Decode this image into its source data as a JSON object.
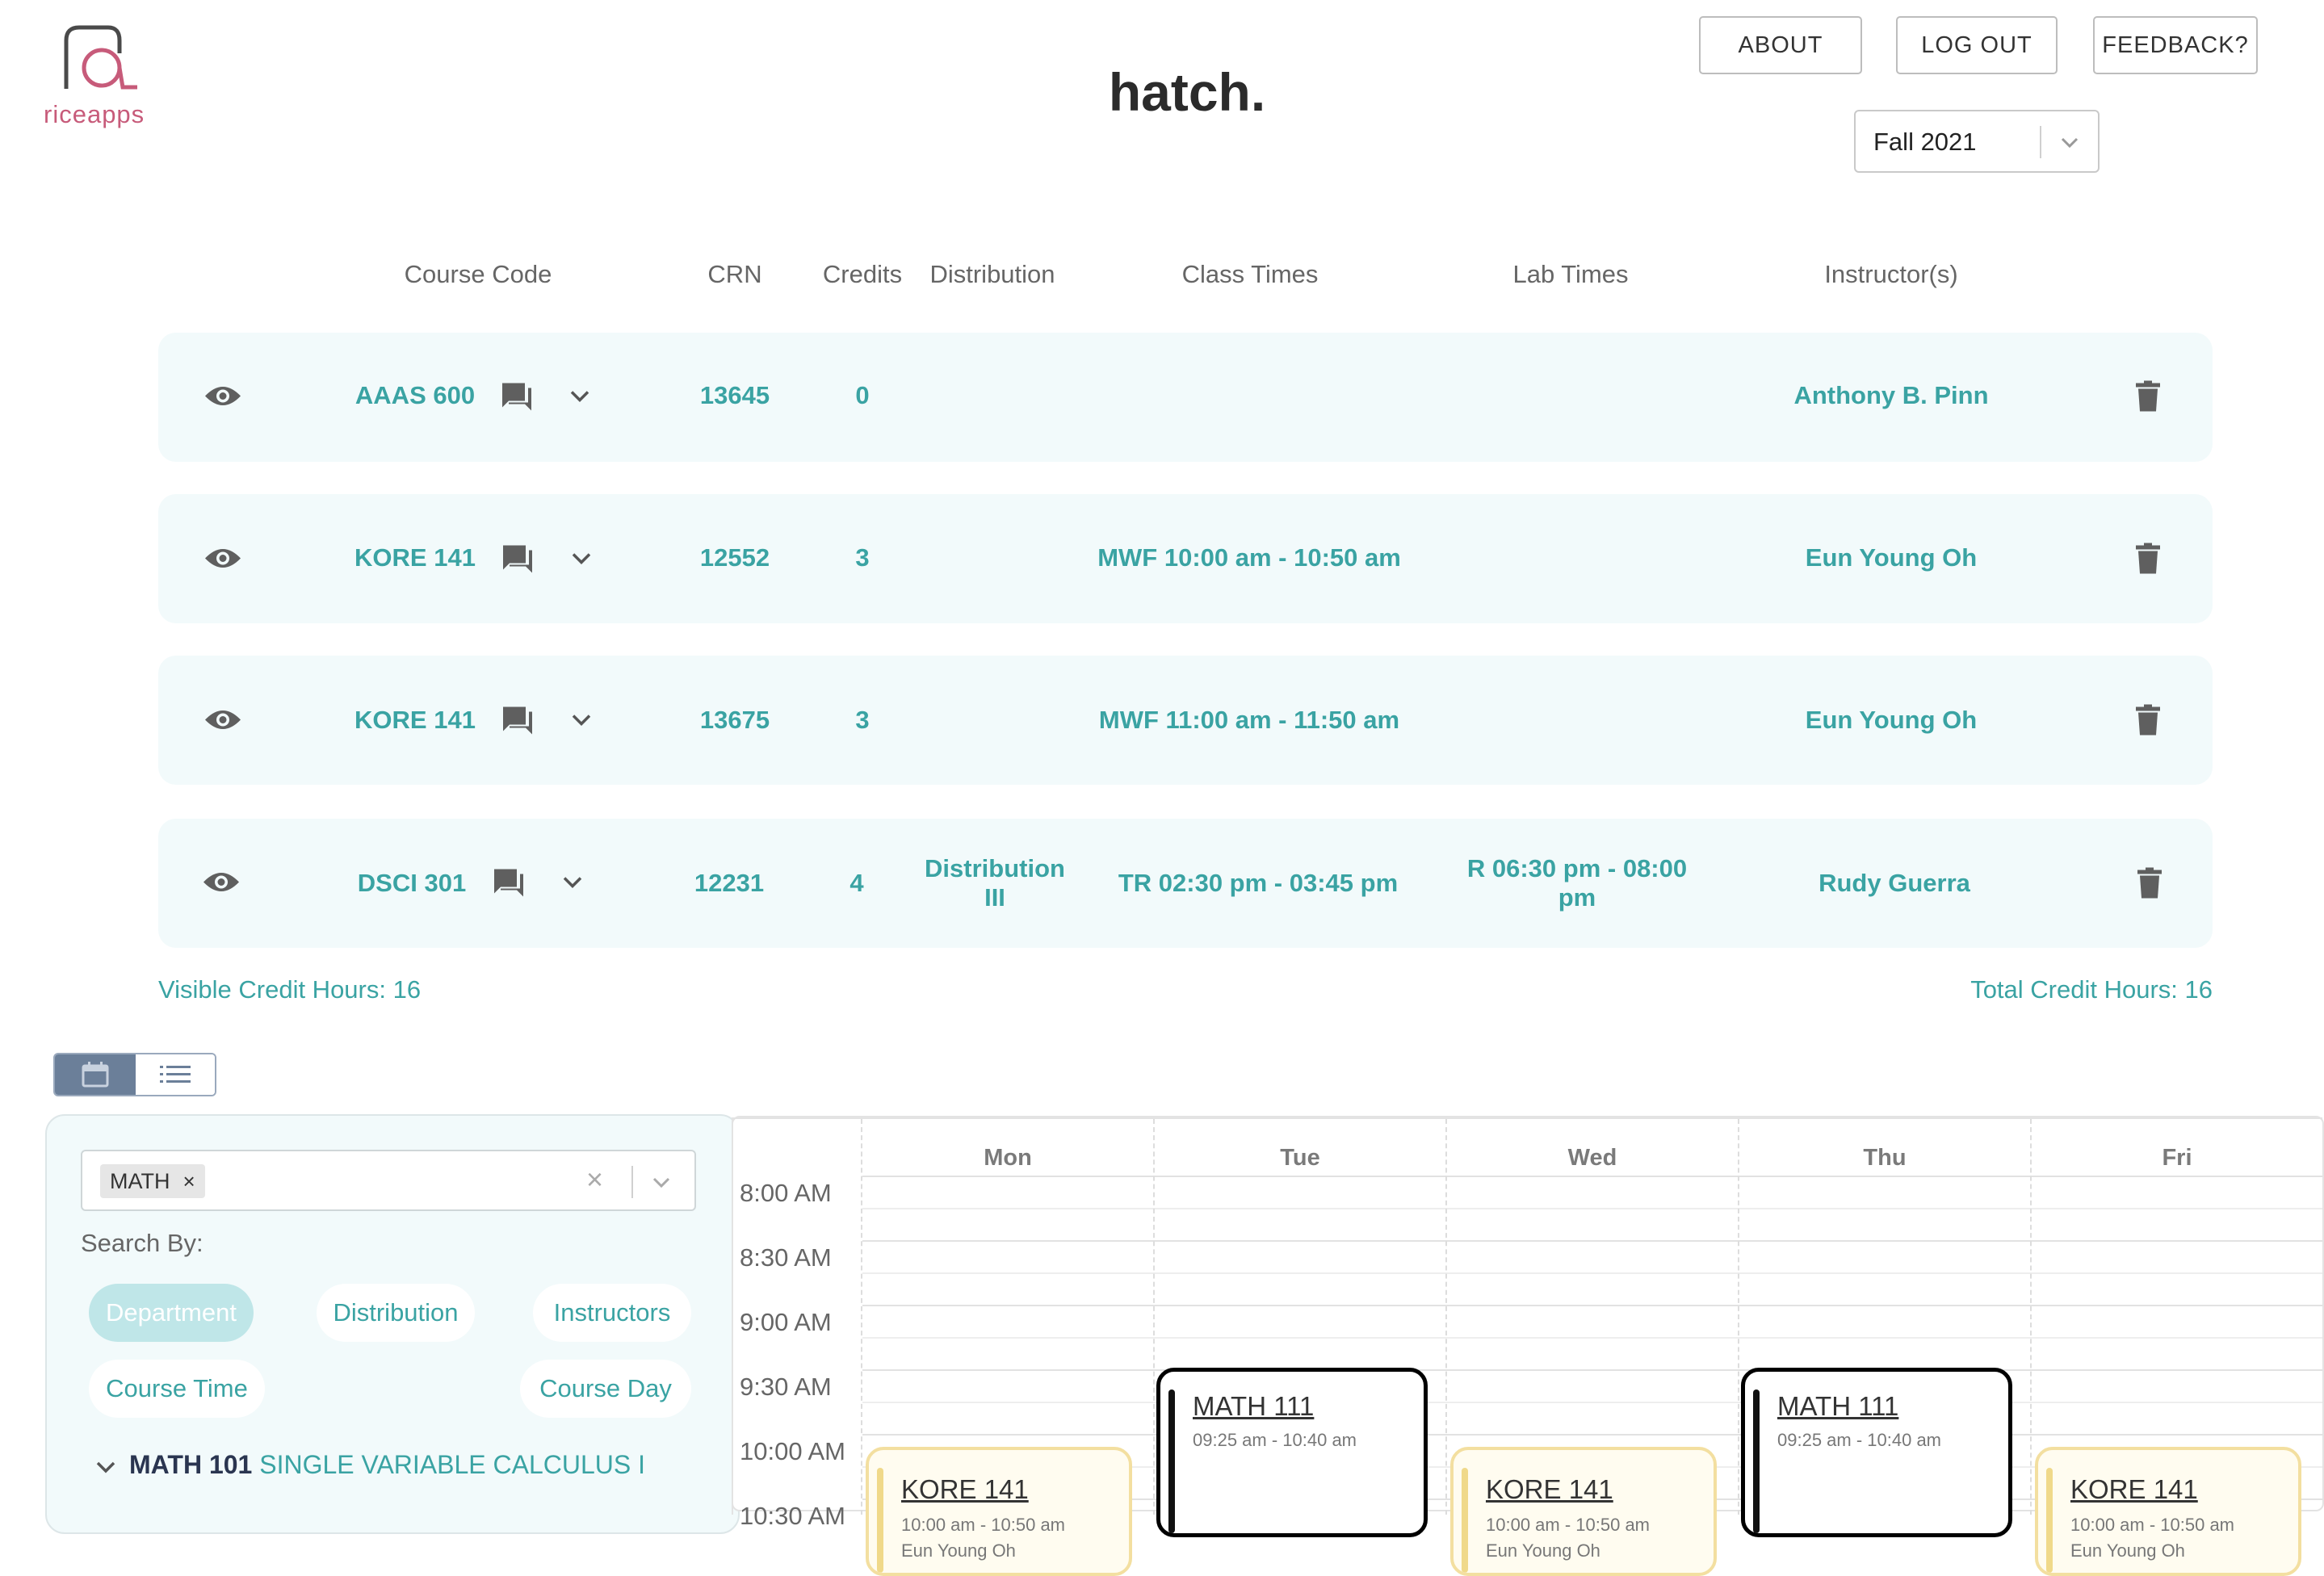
{
  "header": {
    "logo_text": "riceapps",
    "title": "hatch.",
    "buttons": {
      "about": "ABOUT",
      "logout": "LOG OUT",
      "feedback": "FEEDBACK?"
    },
    "term": "Fall 2021"
  },
  "table": {
    "columns": {
      "course_code": "Course Code",
      "crn": "CRN",
      "credits": "Credits",
      "distribution": "Distribution",
      "class_times": "Class Times",
      "lab_times": "Lab Times",
      "instructors": "Instructor(s)"
    },
    "rows": [
      {
        "code": "AAAS 600",
        "crn": "13645",
        "credits": "0",
        "distribution": "",
        "class_times": "",
        "lab_times": "",
        "instructor": "Anthony B. Pinn"
      },
      {
        "code": "KORE 141",
        "crn": "12552",
        "credits": "3",
        "distribution": "",
        "class_times": "MWF 10:00 am - 10:50 am",
        "lab_times": "",
        "instructor": "Eun Young Oh"
      },
      {
        "code": "KORE 141",
        "crn": "13675",
        "credits": "3",
        "distribution": "",
        "class_times": "MWF 11:00 am - 11:50 am",
        "lab_times": "",
        "instructor": "Eun Young Oh"
      },
      {
        "code": "DSCI 301",
        "crn": "12231",
        "credits": "4",
        "distribution": "Distribution III",
        "class_times": "TR 02:30 pm - 03:45 pm",
        "lab_times": "R 06:30 pm - 08:00 pm",
        "instructor": "Rudy Guerra"
      }
    ],
    "visible_credits": "Visible Credit Hours: 16",
    "total_credits": "Total Credit Hours: 16"
  },
  "search": {
    "tag": "MATH",
    "search_by_label": "Search By:",
    "filters": [
      "Department",
      "Distribution",
      "Instructors",
      "Course Time",
      "Course Day"
    ],
    "active_filter": "Department",
    "result": {
      "code": "MATH 101",
      "title": "SINGLE VARIABLE CALCULUS I"
    }
  },
  "calendar": {
    "days": [
      "Mon",
      "Tue",
      "Wed",
      "Thu",
      "Fri"
    ],
    "times": [
      "8:00 AM",
      "8:30 AM",
      "9:00 AM",
      "9:30 AM",
      "10:00 AM",
      "10:30 AM"
    ],
    "events": [
      {
        "day": "Tue",
        "name": "MATH 111",
        "time": "09:25 am - 10:40 am",
        "kind": "math"
      },
      {
        "day": "Thu",
        "name": "MATH 111",
        "time": "09:25 am - 10:40 am",
        "kind": "math"
      },
      {
        "day": "Mon",
        "name": "KORE 141",
        "time": "10:00 am - 10:50 am",
        "instructor": "Eun Young Oh",
        "kind": "kore"
      },
      {
        "day": "Wed",
        "name": "KORE 141",
        "time": "10:00 am - 10:50 am",
        "instructor": "Eun Young Oh",
        "kind": "kore"
      },
      {
        "day": "Fri",
        "name": "KORE 141",
        "time": "10:00 am - 10:50 am",
        "instructor": "Eun Young Oh",
        "kind": "kore"
      }
    ]
  },
  "colors": {
    "accent": "#3aa3a3",
    "brand": "#c75b7a",
    "row_bg": "#f2fafb",
    "pill_active": "#bfe6e8"
  }
}
